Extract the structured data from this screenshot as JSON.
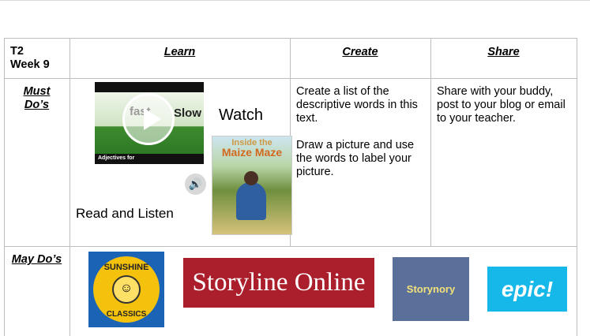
{
  "header": {
    "term_line1": "T2",
    "term_line2": "Week 9",
    "learn": "Learn",
    "create": "Create",
    "share": "Share"
  },
  "must_do": {
    "label_line1": "Must",
    "label_line2": "Do’s",
    "video_thumb": {
      "fast": "fast",
      "slow": "Slow",
      "caption": "Adjectives for"
    },
    "watch": "Watch",
    "read_listen": "Read and Listen",
    "book": {
      "title_line1": "Inside the",
      "title_line2": "Maize Maze"
    },
    "create_line1": "Create a list of the descriptive words in this text.",
    "create_line2": "Draw a picture and use the words to label your picture.",
    "share_text": "Share with your buddy, post to your blog or email to your teacher."
  },
  "may_do": {
    "label": "May Do’s",
    "logos": {
      "sunshine_top": "SUNSHINE",
      "sunshine_bottom": "CLASSICS",
      "storyline": "Storyline Online",
      "storynory": "Storynory",
      "epic": "epic!"
    }
  },
  "icons": [
    "play-icon",
    "speaker-icon",
    "smiley-sun-icon"
  ]
}
